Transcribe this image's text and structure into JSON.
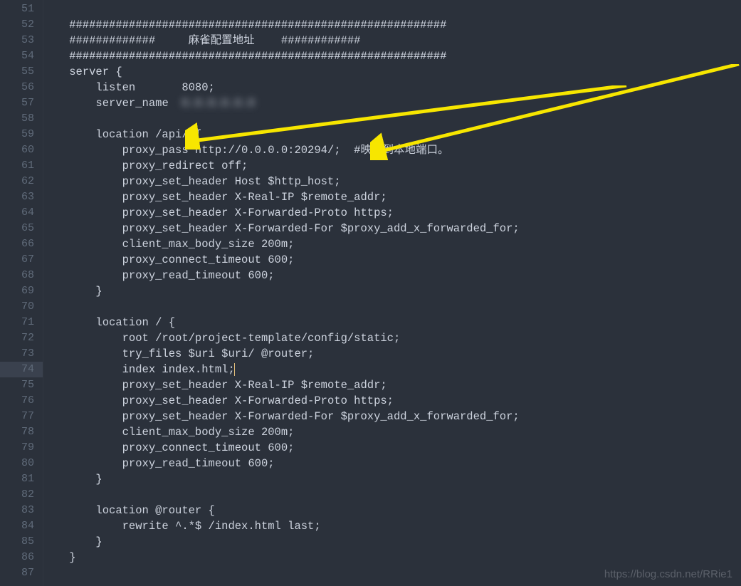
{
  "gutter": {
    "start": 51,
    "end": 87,
    "highlight": 74
  },
  "lines": {
    "51": "",
    "52": "#########################################################",
    "53": "#############     麻雀配置地址    ############",
    "54": "#########################################################",
    "55": "server {",
    "56": "    listen       8080;",
    "57": "    server_name  ",
    "58": "",
    "59": "    location /api/ {",
    "60": "        proxy_pass http://0.0.0.0:20294/;  #映射到本地端口。",
    "61": "        proxy_redirect off;",
    "62": "        proxy_set_header Host $http_host;",
    "63": "        proxy_set_header X-Real-IP $remote_addr;",
    "64": "        proxy_set_header X-Forwarded-Proto https;",
    "65": "        proxy_set_header X-Forwarded-For $proxy_add_x_forwarded_for;",
    "66": "        client_max_body_size 200m;",
    "67": "        proxy_connect_timeout 600;",
    "68": "        proxy_read_timeout 600;",
    "69": "    }",
    "70": "",
    "71": "    location / {",
    "72": "        root /root/project-template/config/static;",
    "73": "        try_files $uri $uri/ @router;",
    "74": "        index index.html;",
    "75": "        proxy_set_header X-Real-IP $remote_addr;",
    "76": "        proxy_set_header X-Forwarded-Proto https;",
    "77": "        proxy_set_header X-Forwarded-For $proxy_add_x_forwarded_for;",
    "78": "        client_max_body_size 200m;",
    "79": "        proxy_connect_timeout 600;",
    "80": "        proxy_read_timeout 600;",
    "81": "    }",
    "82": "",
    "83": "    location @router {",
    "84": "        rewrite ^.*$ /index.html last;",
    "85": "    }",
    "86": "}",
    "87": ""
  },
  "redacted_line": 57,
  "redacted_text": "0.0.0.0.0.0",
  "cursor_line": 74,
  "watermark": "https://blog.csdn.net/RRie1",
  "annotations": {
    "arrow1_target": "location /api/ {",
    "arrow2_target": "proxy_pass http://0.0.0.0:20294/;"
  }
}
